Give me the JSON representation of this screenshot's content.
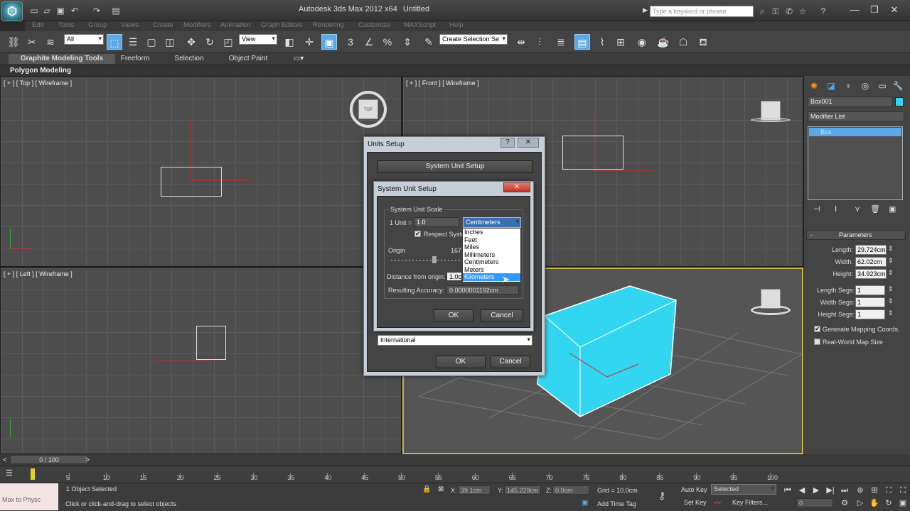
{
  "window": {
    "app_title": "Autodesk 3ds Max  2012 x64",
    "doc_title": "Untitled",
    "search_placeholder": "Type a keyword or phrase",
    "logo": "3ds-max-logo"
  },
  "menu": [
    "Edit",
    "Tools",
    "Group",
    "Views",
    "Create",
    "Modifiers",
    "Animation",
    "Graph Editors",
    "Rendering",
    "Customize",
    "MAXScript",
    "Help"
  ],
  "toolbar": {
    "filter_value": "All",
    "coord_value": "View",
    "selection_set_placeholder": "Create Selection Se"
  },
  "ribbon": {
    "tabs": [
      "Graphite Modeling Tools",
      "Freeform",
      "Selection",
      "Object Paint"
    ],
    "sub": "Polygon Modeling"
  },
  "viewports": {
    "top": "[ + ] [ Top ] [ Wireframe ]",
    "front": "[ + ] [ Front ] [ Wireframe ]",
    "left": "[ + ] [ Left ] [ Wireframe ]",
    "top_cube": "TOP"
  },
  "units_dialog": {
    "title": "Units Setup",
    "help": "?",
    "close": "✕",
    "system_unit_button": "System Unit Setup",
    "display_select": "International",
    "ok": "OK",
    "cancel": "Cancel"
  },
  "system_unit_dialog": {
    "title": "System Unit Setup",
    "close": "✕",
    "group_label": "System Unit Scale",
    "unit_label": "1 Unit =",
    "unit_value": "1.0",
    "unit_select": "Centimeters",
    "respect_label": "Respect System Units in Files",
    "origin_label": "Origin",
    "origin_value": "16777215.0cm",
    "distance_label": "Distance from origin:",
    "distance_value": "1.0cm",
    "accuracy_label": "Resulting Accuracy:",
    "accuracy_value": "0.0000001192cm",
    "ok": "OK",
    "cancel": "Cancel",
    "unit_options": [
      "Inches",
      "Feet",
      "Miles",
      "Millimeters",
      "Centimeters",
      "Meters",
      "Kilometers"
    ],
    "highlighted": "Kilometers"
  },
  "command_panel": {
    "object_name": "Box001",
    "modifier_list": "Modifier List",
    "stack_item": "Box",
    "params_title": "Parameters",
    "length_label": "Length:",
    "length": "29.724cm",
    "width_label": "Width:",
    "width": "62.02cm",
    "height_label": "Height:",
    "height": "34.923cm",
    "lsegs_label": "Length Segs:",
    "lsegs": "1",
    "wsegs_label": "Width Segs:",
    "wsegs": "1",
    "hsegs_label": "Height Segs:",
    "hsegs": "1",
    "gen_map": "Generate Mapping Coords.",
    "real_world": "Real-World Map Size"
  },
  "timeline": {
    "frame": "0 / 100",
    "ticks": [
      "5",
      "10",
      "15",
      "20",
      "25",
      "30",
      "35",
      "40",
      "45",
      "50",
      "55",
      "60",
      "65",
      "70",
      "75",
      "80",
      "85",
      "90",
      "95",
      "100"
    ]
  },
  "status": {
    "maxscript": "Max to Physc",
    "selected": "1 Object Selected",
    "hint": "Click or click-and-drag to select objects",
    "x_label": "X:",
    "x": "39.1cm",
    "y_label": "Y:",
    "y": "145.229cm",
    "z_label": "Z:",
    "z": "0.0cm",
    "grid": "Grid = 10.0cm",
    "auto_key": "Auto Key",
    "set_key": "Set Key",
    "key_sel": "Selected",
    "key_filters": "Key Filters...",
    "add_time_tag": "Add Time Tag",
    "frame_field": "0"
  },
  "colors": {
    "box": "#33d6f0",
    "accent": "#5aa8e8",
    "persp_border": "#c8b44a"
  }
}
